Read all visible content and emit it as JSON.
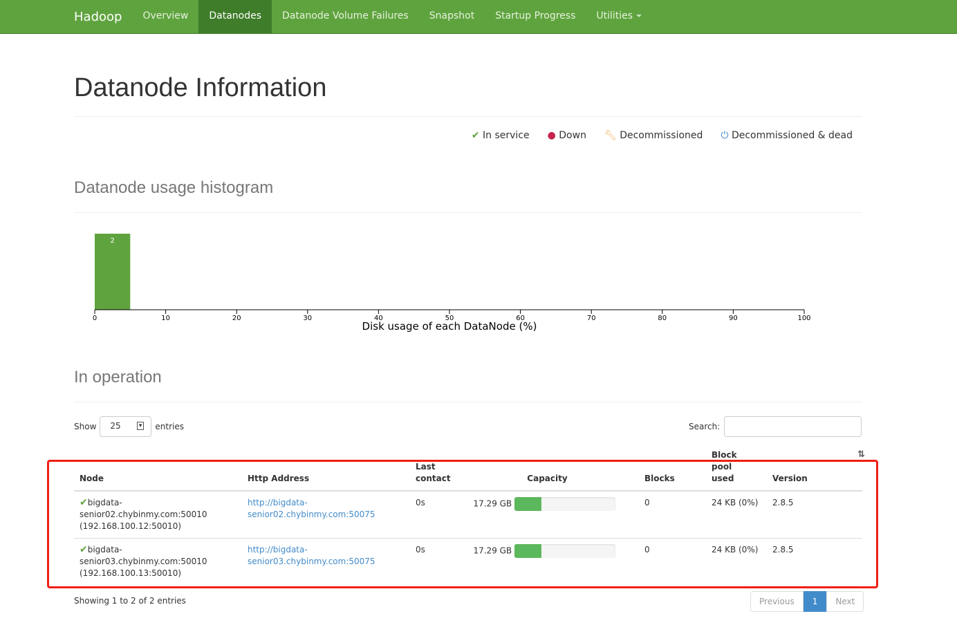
{
  "nav": {
    "brand": "Hadoop",
    "items": [
      "Overview",
      "Datanodes",
      "Datanode Volume Failures",
      "Snapshot",
      "Startup Progress",
      "Utilities"
    ],
    "active": "Datanodes"
  },
  "title": "Datanode Information",
  "legend": [
    {
      "icon": "check-icon",
      "label": "In service",
      "color": "#5fa33e"
    },
    {
      "icon": "exclamation-circle-icon",
      "label": "Down",
      "color": "#c7254e"
    },
    {
      "icon": "wrench-icon",
      "label": "Decommissioned",
      "color": "#f0ad4e"
    },
    {
      "icon": "power-icon",
      "label": "Decommissioned & dead",
      "color": "#428bca"
    }
  ],
  "histogram_title": "Datanode usage histogram",
  "chart_data": {
    "type": "bar",
    "xlabel": "Disk usage of each DataNode (%)",
    "xlim": [
      0,
      100
    ],
    "xticks": [
      0,
      10,
      20,
      30,
      40,
      50,
      60,
      70,
      80,
      90,
      100
    ],
    "bins": [
      {
        "x0": 0,
        "x1": 5,
        "value": 2
      }
    ],
    "color": "#5fa33e"
  },
  "operation_title": "In operation",
  "controls": {
    "show": "Show",
    "entries_value": "25",
    "entries": "entries",
    "search": "Search:"
  },
  "table": {
    "headers": [
      "Node",
      "Http Address",
      "Last contact",
      "Capacity",
      "Blocks",
      "Block pool used",
      "Version"
    ],
    "rows": [
      {
        "node1": "bigdata-",
        "node2": "senior02.chybinmy.com:50010",
        "node3": "(192.168.100.12:50010)",
        "http1": "http://bigdata-",
        "http2": "senior02.chybinmy.com:50075",
        "contact": "0s",
        "capacity": "17.29 GB",
        "usage_percent": 27,
        "blocks": "0",
        "pool": "24 KB (0%)",
        "version": "2.8.5"
      },
      {
        "node1": "bigdata-",
        "node2": "senior03.chybinmy.com:50010",
        "node3": "(192.168.100.13:50010)",
        "http1": "http://bigdata-",
        "http2": "senior03.chybinmy.com:50075",
        "contact": "0s",
        "capacity": "17.29 GB",
        "usage_percent": 27,
        "blocks": "0",
        "pool": "24 KB (0%)",
        "version": "2.8.5"
      }
    ]
  },
  "footer": {
    "info": "Showing 1 to 2 of 2 entries",
    "prev": "Previous",
    "page": "1",
    "next": "Next"
  }
}
